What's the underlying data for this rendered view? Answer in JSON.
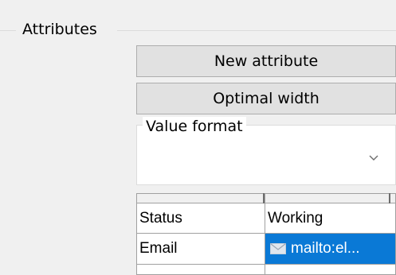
{
  "attributes": {
    "group_title": "Attributes",
    "new_attribute_label": "New attribute",
    "optimal_width_label": "Optimal width",
    "value_format": {
      "label": "Value format",
      "selected": ""
    },
    "table": {
      "rows": [
        {
          "key": "Status",
          "value": "Working"
        },
        {
          "key": "Email",
          "value": "mailto:el..."
        }
      ]
    }
  },
  "icons": {
    "dropdown": "chevron-down-icon",
    "email": "envelope-icon"
  },
  "colors": {
    "selection": "#0a79d6",
    "background": "#f0f0f0",
    "button": "#e1e1e1"
  }
}
